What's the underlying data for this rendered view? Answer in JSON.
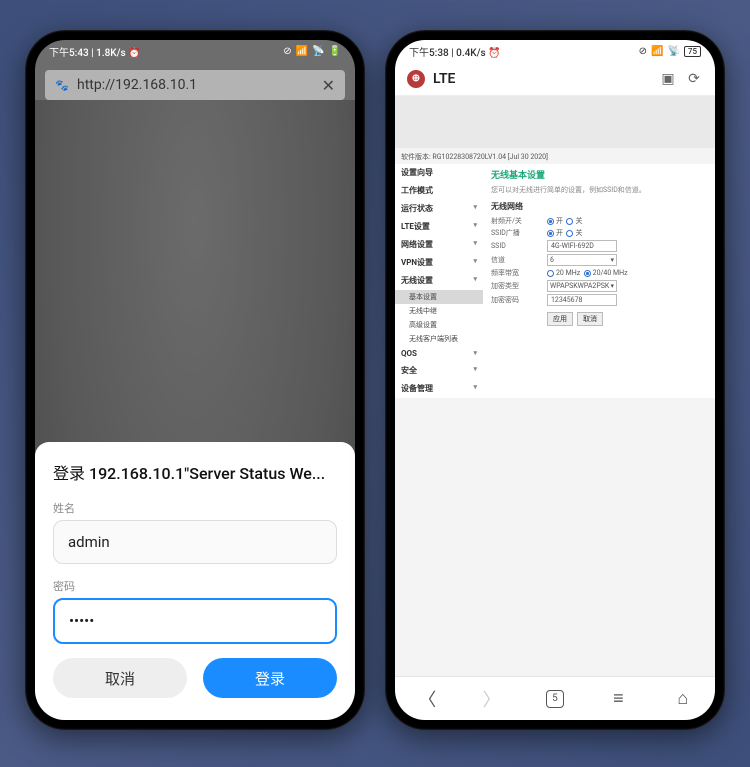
{
  "left": {
    "status": {
      "time": "下午5:43 | 1.8K/s ⏰"
    },
    "urlbar": {
      "url": "http://192.168.10.1"
    },
    "dialog": {
      "title": "登录 192.168.10.1\"Server Status We...",
      "username_label": "姓名",
      "username_value": "admin",
      "password_label": "密码",
      "password_value": "•••••",
      "cancel": "取消",
      "login": "登录"
    }
  },
  "right": {
    "status": {
      "time": "下午5:38 | 0.4K/s ⏰"
    },
    "titlebar": {
      "title": "LTE"
    },
    "firmware": "软件版本: RG10228308720LV1.04 [Jul 30 2020]",
    "sidebar": {
      "items": [
        {
          "label": "设置向导"
        },
        {
          "label": "工作模式"
        },
        {
          "label": "运行状态",
          "caret": true
        },
        {
          "label": "LTE设置",
          "caret": true
        },
        {
          "label": "网络设置",
          "caret": true
        },
        {
          "label": "VPN设置",
          "caret": true
        },
        {
          "label": "无线设置",
          "caret": true
        }
      ],
      "subs": [
        {
          "label": "基本设置",
          "active": true
        },
        {
          "label": "无线中继"
        },
        {
          "label": "高级设置"
        },
        {
          "label": "无线客户端列表"
        }
      ],
      "tail": [
        {
          "label": "QOS",
          "caret": true
        },
        {
          "label": "安全",
          "caret": true
        },
        {
          "label": "设备管理",
          "caret": true
        }
      ]
    },
    "content": {
      "title": "无线基本设置",
      "subtitle": "您可以对无线进行简单的设置，例如SSID和信道。",
      "section": "无线网络",
      "rows": {
        "radio_label": "射频开/关",
        "on": "开",
        "off": "关",
        "broadcast_label": "SSID广播",
        "ssid_label": "SSID",
        "ssid_value": "4G-WIFI-692D",
        "channel_label": "信道",
        "channel_value": "6",
        "bw_label": "频率带宽",
        "bw_opt1": "20 MHz",
        "bw_opt2": "20/40 MHz",
        "enc_label": "加密类型",
        "enc_value": "WPAPSKWPA2PSK",
        "pwd_label": "加密密码",
        "pwd_value": "12345678"
      },
      "apply": "应用",
      "cancel": "取消"
    },
    "nav": {
      "tabs": "5"
    }
  }
}
